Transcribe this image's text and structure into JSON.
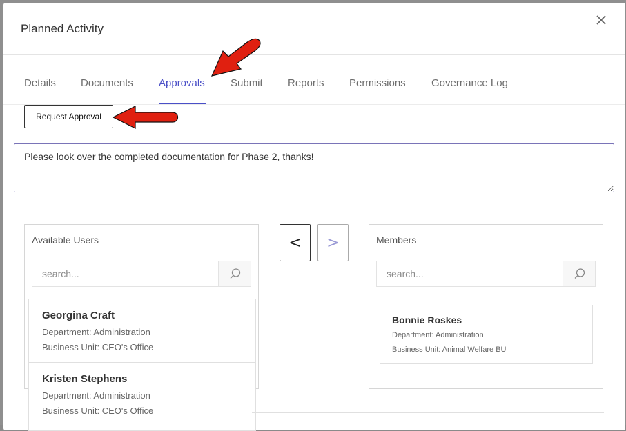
{
  "modal": {
    "title": "Planned Activity",
    "close_label": "×"
  },
  "tabs": [
    {
      "label": "Details",
      "active": false
    },
    {
      "label": "Documents",
      "active": false
    },
    {
      "label": "Approvals",
      "active": true
    },
    {
      "label": "Submit",
      "active": false
    },
    {
      "label": "Reports",
      "active": false
    },
    {
      "label": "Permissions",
      "active": false
    },
    {
      "label": "Governance Log",
      "active": false
    }
  ],
  "approvals": {
    "request_button_label": "Request Approval",
    "comment_text": "Please look over the completed documentation for Phase 2, thanks!"
  },
  "available_users": {
    "title": "Available Users",
    "search_placeholder": "search...",
    "users": [
      {
        "name": "Georgina Craft",
        "department": "Department: Administration",
        "business_unit": "Business Unit: CEO's Office"
      },
      {
        "name": "Kristen Stephens",
        "department": "Department: Administration",
        "business_unit": "Business Unit: CEO's Office"
      }
    ]
  },
  "transfer": {
    "left_label": "<",
    "right_label": ">"
  },
  "members": {
    "title": "Members",
    "search_placeholder": "search...",
    "users": [
      {
        "name": "Bonnie Roskes",
        "department": "Department: Administration",
        "business_unit": "Business Unit: Animal Welfare BU"
      }
    ]
  },
  "colors": {
    "accent": "#4a4fc7",
    "annotation_arrow": "#e02010"
  },
  "icons": {
    "search": "search-icon",
    "close": "close-icon",
    "annotation": "red-arrow-icon"
  }
}
